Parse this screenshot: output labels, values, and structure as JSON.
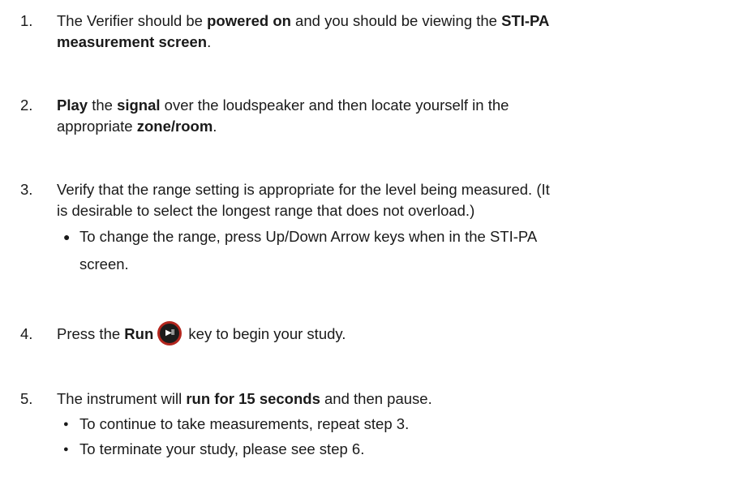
{
  "steps": [
    {
      "num": "1.",
      "l1_a": "The Verifier should be ",
      "l1_b": "powered on",
      "l1_c": " and you should be viewing the ",
      "l1_d": "STI-PA",
      "l2_a": "measurement screen",
      "l2_b": "."
    },
    {
      "num": "2.",
      "l1_a": "Play",
      "l1_b": " the ",
      "l1_c": "signal",
      "l1_d": " over the loudspeaker and then locate yourself in the",
      "l2_a": "appropriate ",
      "l2_b": "zone/room",
      "l2_c": "."
    },
    {
      "num": "3.",
      "l1": "Verify that the range setting is appropriate for the level being measured.  (It",
      "l2": "is desirable to select the longest range that does not overload.)",
      "bullet_dot": "●",
      "bullet_l1": "To change the range, press Up/Down Arrow keys when in the STI-PA",
      "bullet_l2": "screen."
    },
    {
      "num": "4.",
      "a": "Press the ",
      "b": "Run",
      "icon_glyph": "▶II",
      "c": " key to begin your study."
    },
    {
      "num": "5.",
      "a": "The instrument will ",
      "b": "run for 15 seconds",
      "c": " and then pause.",
      "bullet_dot": "●",
      "bullets": [
        "To continue to take measurements, repeat step 3.",
        "To terminate your study, please see step 6."
      ]
    }
  ],
  "colors": {
    "text": "#1a1a1a",
    "run_icon_ring": "#b3261e",
    "run_icon_fill": "#1c1c1c"
  },
  "icons": {
    "run_key": "play-pause-icon"
  }
}
